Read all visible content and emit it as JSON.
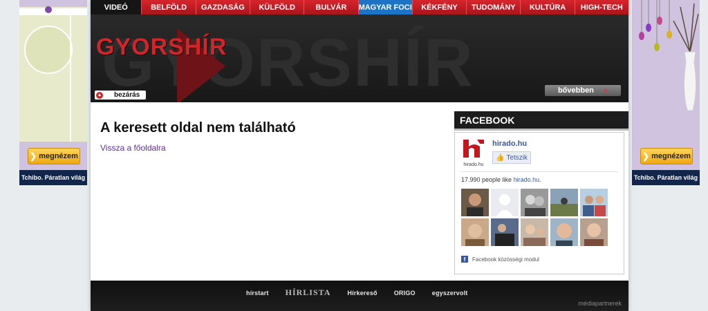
{
  "nav": {
    "items": [
      "VIDEÓ",
      "BELFÖLD",
      "GAZDASÁG",
      "KÜLFÖLD",
      "BULVÁR",
      "MAGYAR FOCI",
      "KÉKFÉNY",
      "TUDOMÁNY",
      "KULTÚRA",
      "HIGH-TECH"
    ],
    "active": "MAGYAR FOCI"
  },
  "hero": {
    "title": "GYORSHÍR",
    "close_label": "bezárás",
    "more_label": "bővebben"
  },
  "main": {
    "heading": "A keresett oldal nem található",
    "back_link": "Vissza a főoldalra"
  },
  "facebook": {
    "title": "FACEBOOK",
    "page_name": "hirado.hu",
    "logo_caption": "hirado.hu",
    "like_label": "Tetszik",
    "count_prefix": "17.990 people like",
    "count_link": "hirado.hu",
    "count_suffix": ".",
    "footer": "Facebook közösségi modul"
  },
  "ads": {
    "cta": "megnézem",
    "brand": "Tchibo. Páratlan világ"
  },
  "footer": {
    "partners": [
      "hírstart",
      "HÍRLISTA",
      "Hírkereső",
      "ORIGO",
      "egyszervolt"
    ],
    "label": "médiapartnerek"
  },
  "colors": {
    "nav_red": "#c4161e",
    "nav_active": "#1d74c4",
    "facebook_blue": "#3b5998",
    "link_purple": "#5c2f92"
  }
}
